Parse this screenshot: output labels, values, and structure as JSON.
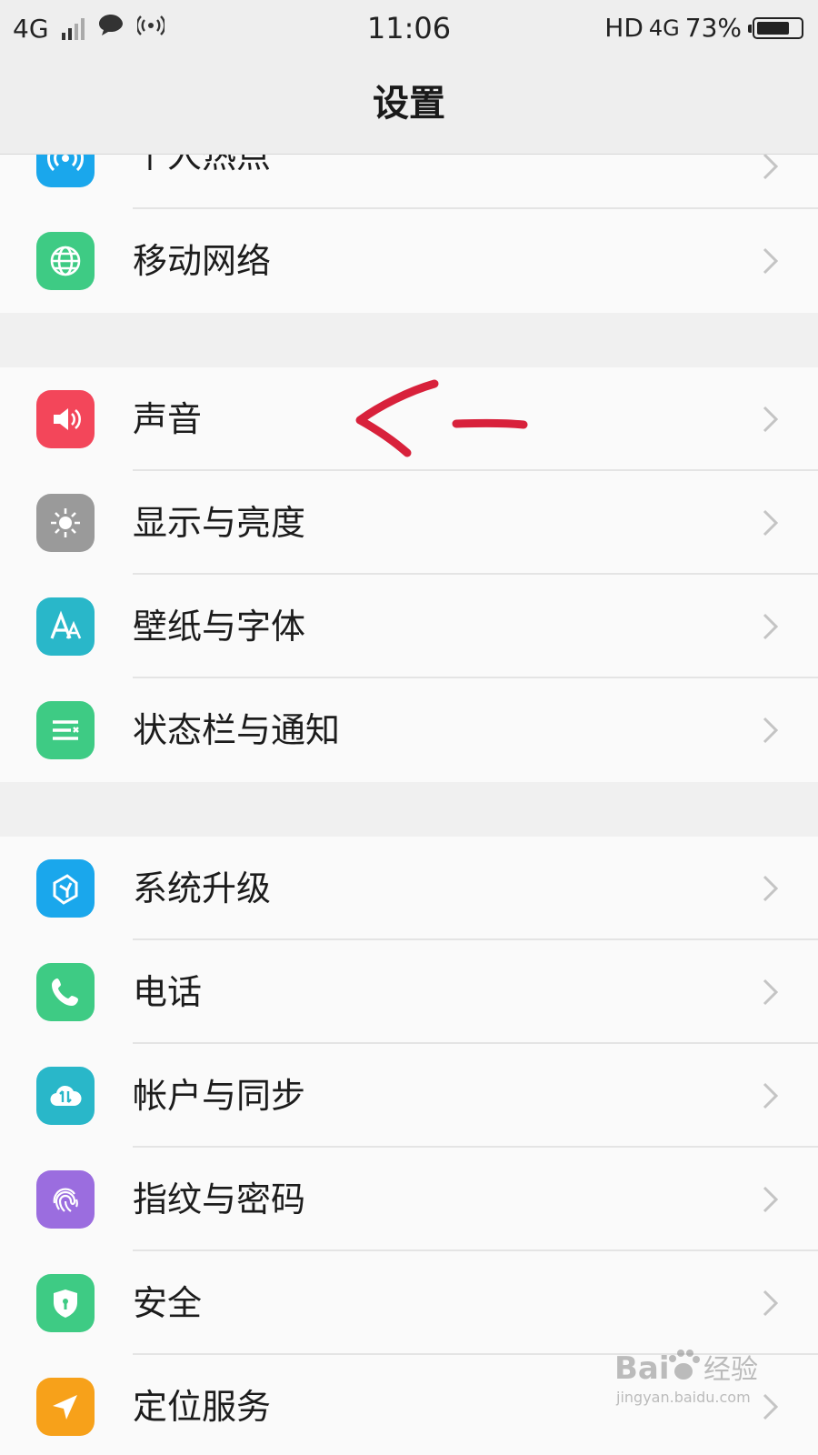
{
  "status_bar": {
    "left_network": "4G",
    "time": "11:06",
    "right_hd": "HD",
    "right_network": "4G",
    "battery_text": "73%",
    "battery_level": 0.73
  },
  "header": {
    "title": "设置"
  },
  "groups": [
    {
      "items": [
        {
          "label": "个人热点",
          "icon": "hotspot-icon",
          "color": "#1aa7ec"
        },
        {
          "label": "移动网络",
          "icon": "globe-icon",
          "color": "#3ecb84"
        }
      ]
    },
    {
      "items": [
        {
          "label": "声音",
          "icon": "speaker-icon",
          "color": "#f3465a"
        },
        {
          "label": "显示与亮度",
          "icon": "brightness-icon",
          "color": "#9a9a9a"
        },
        {
          "label": "壁纸与字体",
          "icon": "font-icon",
          "color": "#29b7c9"
        },
        {
          "label": "状态栏与通知",
          "icon": "notification-icon",
          "color": "#3ecb84"
        }
      ]
    },
    {
      "items": [
        {
          "label": "系统升级",
          "icon": "upgrade-icon",
          "color": "#1aa7ec"
        },
        {
          "label": "电话",
          "icon": "phone-icon",
          "color": "#3ecb84"
        },
        {
          "label": "帐户与同步",
          "icon": "cloud-sync-icon",
          "color": "#29b7c9"
        },
        {
          "label": "指纹与密码",
          "icon": "fingerprint-icon",
          "color": "#9b6ddf"
        },
        {
          "label": "安全",
          "icon": "shield-icon",
          "color": "#3ecb84"
        },
        {
          "label": "定位服务",
          "icon": "location-icon",
          "color": "#f7a11a"
        }
      ]
    }
  ],
  "watermark": {
    "brand_left": "Bai",
    "brand_right": "经验",
    "url": "jingyan.baidu.com"
  }
}
